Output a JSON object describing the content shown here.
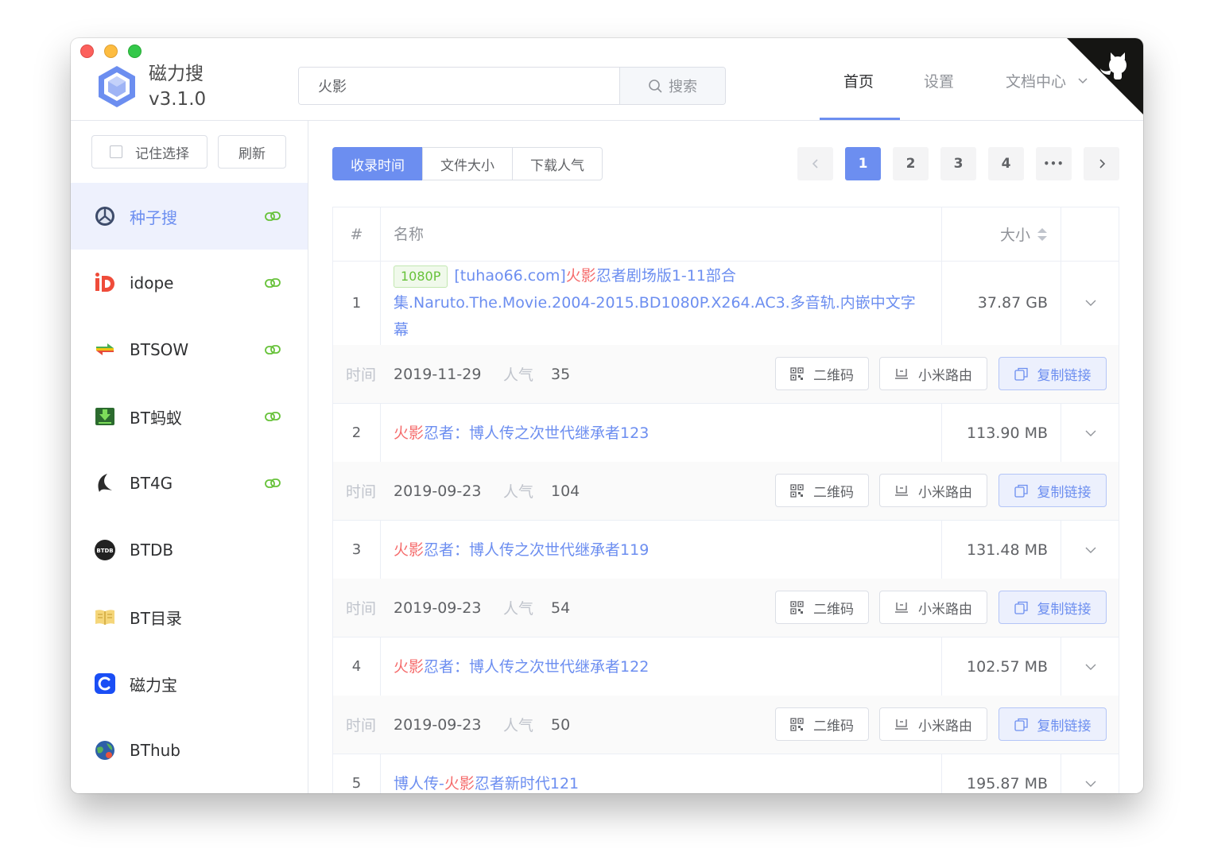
{
  "app": {
    "name": "磁力搜",
    "version": "v3.1.0"
  },
  "search": {
    "value": "火影",
    "button_label": "搜索"
  },
  "nav": {
    "tabs": [
      {
        "label": "首页",
        "active": true
      },
      {
        "label": "设置",
        "active": false
      },
      {
        "label": "文档中心",
        "active": false
      }
    ]
  },
  "sidebar": {
    "remember_label": "记住选择",
    "refresh_label": "刷新",
    "sources": [
      {
        "label": "种子搜",
        "icon": "zhongzisou-icon",
        "active": true,
        "link": true
      },
      {
        "label": "idope",
        "icon": "idope-icon",
        "active": false,
        "link": true
      },
      {
        "label": "BTSOW",
        "icon": "btsow-icon",
        "active": false,
        "link": true
      },
      {
        "label": "BT蚂蚁",
        "icon": "btmayi-icon",
        "active": false,
        "link": true
      },
      {
        "label": "BT4G",
        "icon": "bt4g-icon",
        "active": false,
        "link": true
      },
      {
        "label": "BTDB",
        "icon": "btdb-icon",
        "active": false,
        "link": false
      },
      {
        "label": "BT目录",
        "icon": "btmulu-icon",
        "active": false,
        "link": false
      },
      {
        "label": "磁力宝",
        "icon": "cilibao-icon",
        "active": false,
        "link": false
      },
      {
        "label": "BThub",
        "icon": "bthub-icon",
        "active": false,
        "link": false
      }
    ]
  },
  "sort": {
    "options": [
      "收录时间",
      "文件大小",
      "下载人气"
    ],
    "active_index": 0
  },
  "pagination": {
    "pages": [
      "1",
      "2",
      "3",
      "4"
    ],
    "current": "1",
    "more": "•••"
  },
  "table": {
    "headers": {
      "index": "#",
      "name": "名称",
      "size": "大小"
    },
    "detail_labels": {
      "time": "时间",
      "popularity": "人气"
    },
    "actions": {
      "qrcode": "二维码",
      "xiaomi": "小米路由",
      "copy": "复制链接"
    },
    "rows": [
      {
        "index": "1",
        "tag": "1080P",
        "name_parts": [
          "[tuhao66.com]",
          "火影",
          "忍者剧场版1-11部合集.Naruto.The.Movie.2004-2015.BD1080P.X264.AC3.多音轨.内嵌中文字幕"
        ],
        "size": "37.87 GB",
        "time": "2019-11-29",
        "popularity": "35"
      },
      {
        "index": "2",
        "tag": "",
        "name_parts": [
          "",
          "火影",
          "忍者：博人传之次世代继承者123"
        ],
        "size": "113.90 MB",
        "time": "2019-09-23",
        "popularity": "104"
      },
      {
        "index": "3",
        "tag": "",
        "name_parts": [
          "",
          "火影",
          "忍者：博人传之次世代继承者119"
        ],
        "size": "131.48 MB",
        "time": "2019-09-23",
        "popularity": "54"
      },
      {
        "index": "4",
        "tag": "",
        "name_parts": [
          "",
          "火影",
          "忍者：博人传之次世代继承者122"
        ],
        "size": "102.57 MB",
        "time": "2019-09-23",
        "popularity": "50"
      },
      {
        "index": "5",
        "tag": "",
        "name_parts": [
          "博人传-",
          "火影",
          "忍者新时代121"
        ],
        "size": "195.87 MB",
        "time": "",
        "popularity": ""
      }
    ]
  },
  "colors": {
    "primary": "#6c8ef0",
    "highlight": "#f56c6c",
    "tag_green": "#67c23a",
    "link_green": "#67c23a"
  }
}
